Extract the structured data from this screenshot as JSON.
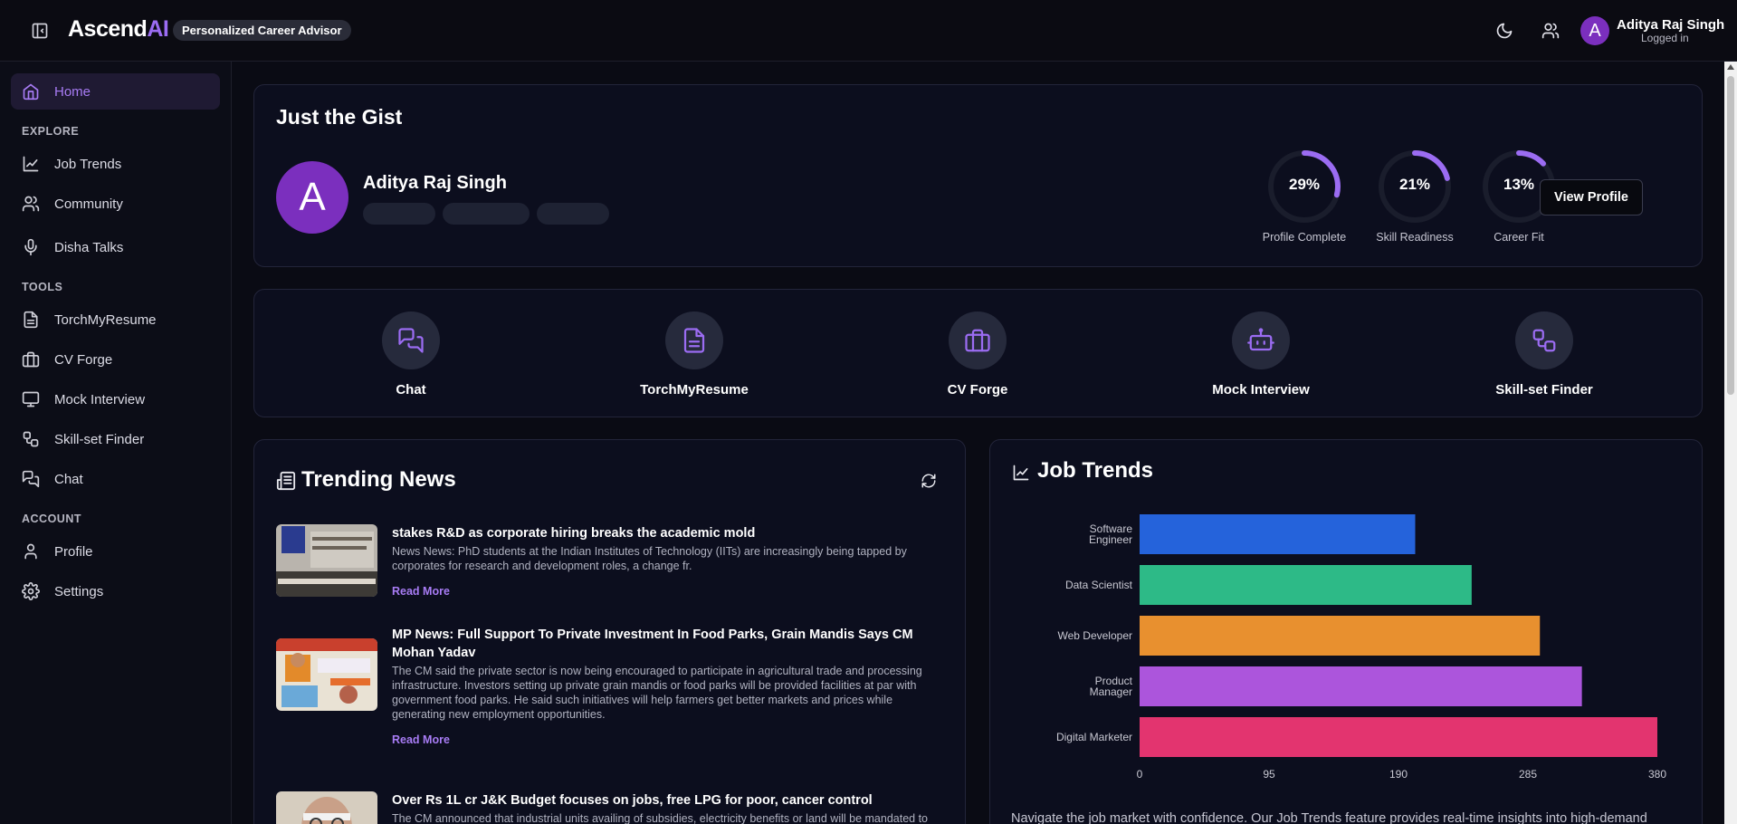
{
  "header": {
    "logo_main": "Ascend",
    "logo_accent": "AI",
    "tagline": "Personalized Career Advisor",
    "user_initial": "A",
    "user_name": "Aditya Raj Singh",
    "user_status": "Logged in"
  },
  "sidebar": {
    "home": "Home",
    "explore_label": "EXPLORE",
    "explore": [
      "Job Trends",
      "Community",
      "Disha Talks"
    ],
    "tools_label": "TOOLS",
    "tools": [
      "TorchMyResume",
      "CV Forge",
      "Mock Interview",
      "Skill-set Finder",
      "Chat"
    ],
    "account_label": "ACCOUNT",
    "account": [
      "Profile",
      "Settings"
    ]
  },
  "gist": {
    "title": "Just the Gist",
    "initial": "A",
    "name": "Aditya Raj Singh",
    "metrics": [
      {
        "value": "29%",
        "label": "Profile Complete",
        "fraction": 0.29
      },
      {
        "value": "21%",
        "label": "Skill Readiness",
        "fraction": 0.21
      },
      {
        "value": "13%",
        "label": "Career Fit",
        "fraction": 0.13
      }
    ],
    "view_profile": "View Profile",
    "accent": "#9b6cf2"
  },
  "tools": [
    "Chat",
    "TorchMyResume",
    "CV Forge",
    "Mock Interview",
    "Skill-set Finder"
  ],
  "news": {
    "title": "Trending News",
    "read_more": "Read More",
    "items": [
      {
        "headline": "stakes R&D as corporate hiring breaks the academic mold",
        "body": "News News: PhD students at the Indian Institutes of Technology (IITs) are increasingly being tapped by corporates for research and development roles, a change fr."
      },
      {
        "headline": "MP News: Full Support To Private Investment In Food Parks, Grain Mandis Says CM Mohan Yadav",
        "body": "The CM said the private sector is now being encouraged to participate in agricultural trade and processing infrastructure. Investors setting up private grain mandis or food parks will be provided facilities at par with government food parks. He said such initiatives will help farmers get better markets and prices while generating new employment opportunities."
      },
      {
        "headline": "Over Rs 1L cr J&K Budget focuses on jobs, free LPG for poor, cancer control",
        "body": "The CM announced that industrial units availing of subsidies, electricity benefits or land will be mandated to"
      }
    ]
  },
  "job_trends": {
    "title": "Job Trends",
    "description": "Navigate the job market with confidence. Our Job Trends feature provides real-time insights into high-demand"
  },
  "chart_data": {
    "type": "bar",
    "orientation": "horizontal",
    "categories": [
      "Software Engineer",
      "Data Scientist",
      "Web Developer",
      "Product Manager",
      "Digital Marketer"
    ],
    "category_lines": [
      [
        "Software",
        "Engineer"
      ],
      [
        "Data Scientist"
      ],
      [
        "Web Developer"
      ],
      [
        "Product",
        "Manager"
      ],
      [
        "Digital Marketer"
      ]
    ],
    "values": [
      210,
      253,
      305,
      337,
      400
    ],
    "colors": [
      "#2563db",
      "#2dba87",
      "#e8902f",
      "#ac55dc",
      "#e3346f"
    ],
    "xlim": [
      0,
      380
    ],
    "xticks": [
      "0",
      "95",
      "190",
      "285",
      "380"
    ],
    "grid": false
  }
}
